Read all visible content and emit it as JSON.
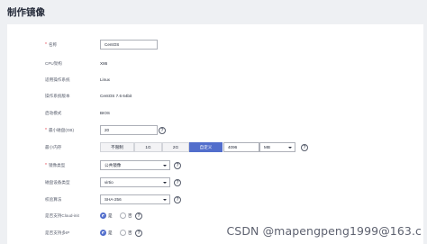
{
  "page": {
    "title": "制作镜像"
  },
  "form": {
    "name": {
      "label": "名称",
      "value": "CentOS"
    },
    "cpu_arch": {
      "label": "CPU架构",
      "value": "X86"
    },
    "os": {
      "label": "适用操作系统",
      "value": "Linux"
    },
    "os_version": {
      "label": "操作系统版本",
      "value": "CentOS 7.6 64bit"
    },
    "boot_mode": {
      "label": "启动模式",
      "value": "BIOS"
    },
    "min_disk": {
      "label": "最小磁盘(GB)",
      "value": "20"
    },
    "min_memory": {
      "label": "最小内存",
      "options": [
        "不限制",
        "1G",
        "2G",
        "自定义"
      ],
      "selected": "自定义",
      "value": "4096",
      "unit": "MB"
    },
    "image_type": {
      "label": "镜像类型",
      "value": "公共镜像"
    },
    "disk_device_type": {
      "label": "磁盘设备类型",
      "value": "virtio"
    },
    "checksum": {
      "label": "校验算法",
      "value": "SHA-256"
    },
    "cloud_init": {
      "label": "是否支持Cloud-init",
      "yes": "是",
      "no": "否",
      "selected": "yes"
    },
    "multi_nic_ip": {
      "label": "是否支持多IP",
      "yes": "是",
      "no": "否",
      "selected": "yes"
    }
  },
  "watermark": "CSDN @mapengpeng1999@163.c"
}
